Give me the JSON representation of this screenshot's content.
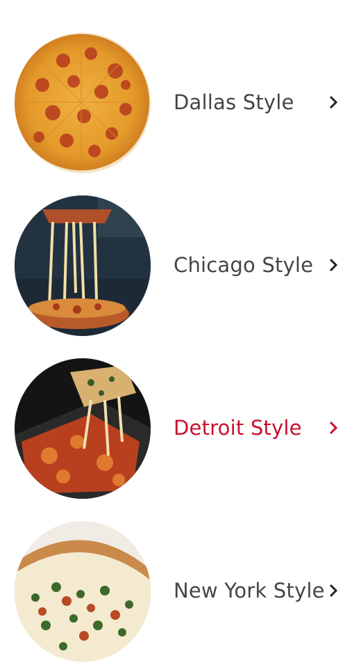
{
  "menu": {
    "items": [
      {
        "label": "Dallas Style",
        "image_icon": "pizza-pepperoni-photo",
        "active": false
      },
      {
        "label": "Chicago Style",
        "image_icon": "pizza-deep-dish-photo",
        "active": false
      },
      {
        "label": "Detroit Style",
        "image_icon": "pizza-detroit-photo",
        "active": true
      },
      {
        "label": "New York Style",
        "image_icon": "pizza-new-york-photo",
        "active": false
      }
    ],
    "chevron_icon": "chevron-right-icon"
  },
  "colors": {
    "text": "#454545",
    "active": "#c8102e",
    "background": "#ffffff"
  }
}
